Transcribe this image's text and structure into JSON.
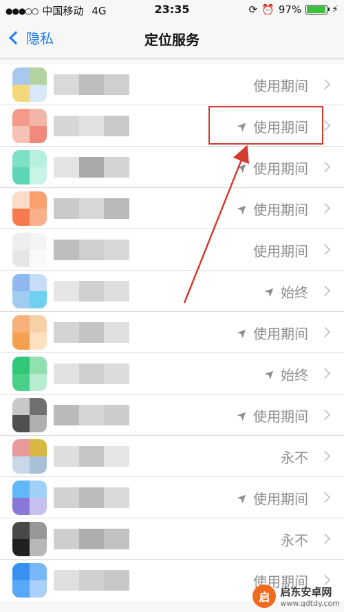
{
  "status_bar": {
    "signal": "●●●○○",
    "carrier": "中国移动",
    "network": "4G",
    "time": "23:35",
    "battery_percent": "97%",
    "battery_level": 0.97
  },
  "nav": {
    "back_label": "隐私",
    "title": "定位服务"
  },
  "rows": [
    {
      "status": "使用期间",
      "arrow": false,
      "icon_colors": [
        "#a8c8f0",
        "#b3d4a0",
        "#f3d97c",
        "#d8e8f8"
      ],
      "name_colors": [
        "#d9d9d9",
        "#bdbdbd",
        "#cfcfcf"
      ]
    },
    {
      "status": "使用期间",
      "arrow": true,
      "icon_colors": [
        "#f59a8a",
        "#f2b6a8",
        "#f7c2b6",
        "#f08a7a"
      ],
      "name_colors": [
        "#d6d6d6",
        "#e2e2e2",
        "#cacaca"
      ]
    },
    {
      "status": "使用期间",
      "arrow": true,
      "icon_colors": [
        "#7fe0c8",
        "#b8f0e0",
        "#5cd6b6",
        "#c8f4e8"
      ],
      "name_colors": [
        "#e4e4e4",
        "#a9a9a9",
        "#d3d3d3"
      ]
    },
    {
      "status": "使用期间",
      "arrow": true,
      "icon_colors": [
        "#fbdcc8",
        "#f8a070",
        "#f77a4f",
        "#fab08a"
      ],
      "name_colors": [
        "#c9c9c9",
        "#d8d8d8",
        "#b9b9b9"
      ]
    },
    {
      "status": "使用期间",
      "arrow": false,
      "icon_colors": [
        "#eeeeee",
        "#f4f4f4",
        "#e6e6e6",
        "#fafafa"
      ],
      "name_colors": [
        "#bebebe",
        "#cfcfcf",
        "#d8d8d8"
      ]
    },
    {
      "status": "始终",
      "arrow": true,
      "icon_colors": [
        "#8fb8f0",
        "#c8dcf8",
        "#a0ccf0",
        "#6fd0f0"
      ],
      "name_colors": [
        "#e6e6e6",
        "#d0d0d0",
        "#dedede"
      ]
    },
    {
      "status": "使用期间",
      "arrow": true,
      "icon_colors": [
        "#f7b07a",
        "#f8d0a8",
        "#f5a050",
        "#fde0c0"
      ],
      "name_colors": [
        "#d4d4d4",
        "#c4c4c4",
        "#e0e0e0"
      ]
    },
    {
      "status": "始终",
      "arrow": true,
      "icon_colors": [
        "#30c878",
        "#90e0b0",
        "#48d088",
        "#b8ecd0"
      ],
      "name_colors": [
        "#e2e2e2",
        "#cfcfcf",
        "#dcdcdc"
      ]
    },
    {
      "status": "使用期间",
      "arrow": true,
      "icon_colors": [
        "#c8c8c8",
        "#707070",
        "#505050",
        "#b0b0b0"
      ],
      "name_colors": [
        "#bababa",
        "#d5d5d5",
        "#cccccc"
      ]
    },
    {
      "status": "永不",
      "arrow": false,
      "icon_colors": [
        "#e89a9a",
        "#d8b840",
        "#c8d8e8",
        "#a8c0d8"
      ],
      "name_colors": [
        "#dedede",
        "#c6c6c6",
        "#e6e6e6"
      ]
    },
    {
      "status": "使用期间",
      "arrow": true,
      "icon_colors": [
        "#60b8f8",
        "#a0d0f8",
        "#8878d8",
        "#c8c0f0"
      ],
      "name_colors": [
        "#d2d2d2",
        "#bcbcbc",
        "#dadada"
      ]
    },
    {
      "status": "永不",
      "arrow": false,
      "icon_colors": [
        "#484848",
        "#989898",
        "#202020",
        "#b8b8b8"
      ],
      "name_colors": [
        "#cecece",
        "#aeaeae",
        "#c2c2c2"
      ]
    },
    {
      "status": "使用期间",
      "arrow": false,
      "icon_colors": [
        "#3890f0",
        "#78b8f8",
        "#58a8f8",
        "#a8d0f8"
      ],
      "name_colors": [
        "#e0e0e0",
        "#d0d0d0",
        "#c8c8c8"
      ]
    }
  ],
  "watermark": {
    "title": "启东安卓网",
    "url": "www.qdtdy.com",
    "logo_glyph": "启"
  },
  "colors": {
    "accent": "#1a7cf5",
    "highlight": "#d23b30",
    "secondary_text": "#8e8e93"
  }
}
